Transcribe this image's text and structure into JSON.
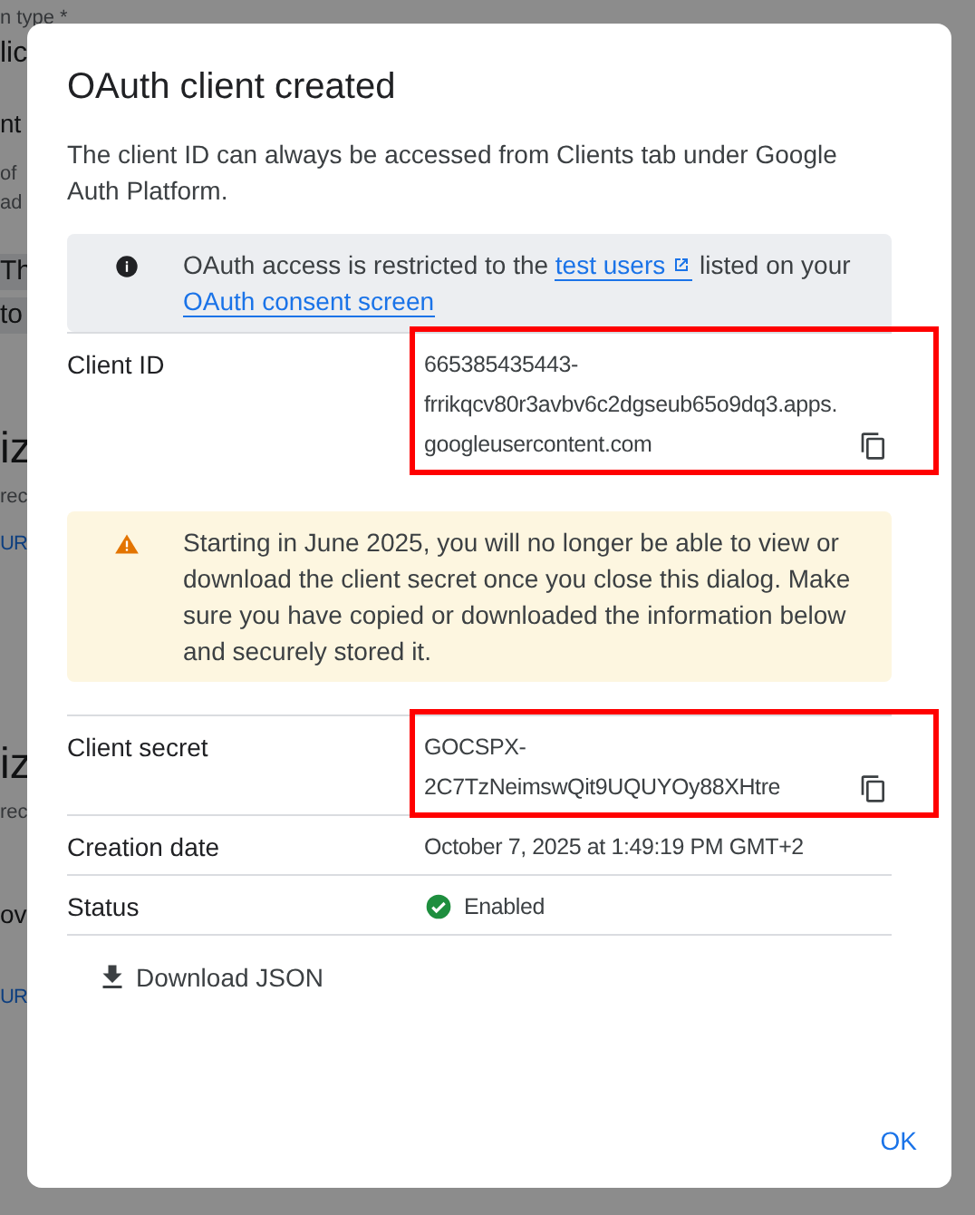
{
  "background": {
    "fragments": [
      {
        "kind": "caption",
        "text": "n type *"
      },
      {
        "kind": "field",
        "text": "lic"
      },
      {
        "kind": "body",
        "text": "nt"
      },
      {
        "kind": "caption",
        "text": "of"
      },
      {
        "kind": "caption",
        "text": "ad"
      },
      {
        "kind": "band",
        "text": "Th"
      },
      {
        "kind": "band",
        "text": "to"
      },
      {
        "kind": "heading",
        "text": "iz"
      },
      {
        "kind": "caption",
        "text": "rec"
      },
      {
        "kind": "link",
        "text": "UR"
      },
      {
        "kind": "heading",
        "text": "iz"
      },
      {
        "kind": "caption",
        "text": "rec"
      },
      {
        "kind": "body",
        "text": "ov"
      },
      {
        "kind": "link",
        "text": "UR"
      }
    ]
  },
  "dialog": {
    "title": "OAuth client created",
    "intro": "The client ID can always be accessed from Clients tab under Google Auth Platform.",
    "sections": [
      {
        "kind": "info",
        "parts": [
          {
            "kind": "text",
            "text": "OAuth access is restricted to the "
          },
          {
            "kind": "link",
            "text": "test users",
            "external": true
          },
          {
            "kind": "text",
            "text": " listed on your "
          },
          {
            "kind": "link",
            "text": "OAuth consent screen",
            "external": false
          }
        ]
      },
      {
        "kind": "row",
        "label": "Client ID",
        "value": "665385435443-frrikqcv80r3avbv6c2dgseub65o9dq3.apps.googleusercontent.com",
        "copy": true,
        "highlighted": true
      },
      {
        "kind": "warning",
        "parts": [
          {
            "kind": "text",
            "text": "Starting in June 2025, you will no longer be able to view or download the client secret once you close this dialog. Make sure you have copied or downloaded the information below and securely stored it."
          }
        ]
      },
      {
        "kind": "row",
        "label": "Client secret",
        "value": "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",
        "copy": true,
        "highlighted": true
      },
      {
        "kind": "row",
        "label": "Creation date",
        "value": "October 7, 2025 at 1:49:19 PM GMT+2",
        "copy": false,
        "highlighted": false
      },
      {
        "kind": "status",
        "label": "Status",
        "value": "Enabled",
        "enabled": true
      }
    ],
    "download": "Download JSON",
    "ok": "OK"
  }
}
